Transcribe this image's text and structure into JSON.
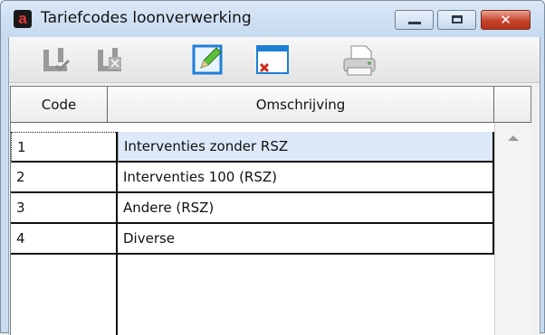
{
  "window": {
    "title": "Tariefcodes loonverwerking",
    "app_icon_letter": "a",
    "close_glyph": "✕"
  },
  "toolbar": {
    "buttons": [
      {
        "icon": "save-confirm-icon",
        "enabled": false
      },
      {
        "icon": "save-cancel-icon",
        "enabled": false
      },
      {
        "icon": "edit-pencil-icon",
        "enabled": true
      },
      {
        "icon": "close-form-icon",
        "enabled": true
      },
      {
        "icon": "printer-icon",
        "enabled": true
      }
    ]
  },
  "grid": {
    "columns": [
      "Code",
      "Omschrijving"
    ],
    "rows": [
      {
        "code": "1",
        "omschrijving": "Interventies zonder RSZ",
        "selected": true
      },
      {
        "code": "2",
        "omschrijving": "Interventies 100 (RSZ)",
        "selected": false
      },
      {
        "code": "3",
        "omschrijving": "Andere (RSZ)",
        "selected": false
      },
      {
        "code": "4",
        "omschrijving": "Diverse",
        "selected": false
      }
    ]
  },
  "colors": {
    "title_bar": "#c9dbef",
    "selected_row": "#dde9f8",
    "close_button": "#c7432b"
  }
}
